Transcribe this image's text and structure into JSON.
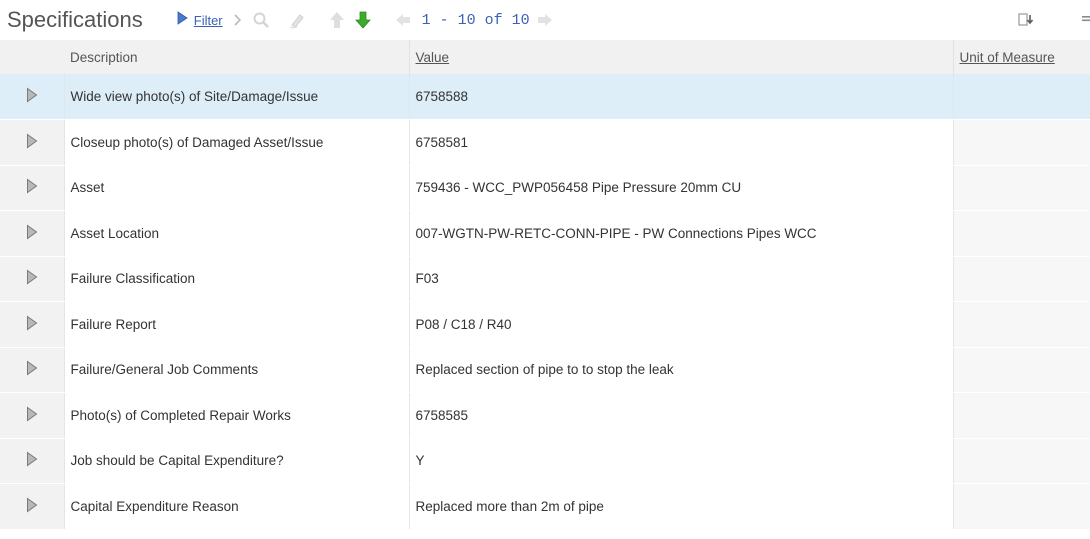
{
  "toolbar": {
    "title": "Specifications",
    "filter_label": "Filter",
    "pager_text": "1 - 10 of 10"
  },
  "table": {
    "headers": {
      "description": "Description",
      "value": "Value",
      "unit": "Unit of Measure"
    },
    "rows": [
      {
        "description": "Wide view photo(s) of Site/Damage/Issue",
        "value": "6758588",
        "unit": ""
      },
      {
        "description": "Closeup photo(s) of Damaged Asset/Issue",
        "value": "6758581",
        "unit": ""
      },
      {
        "description": "Asset",
        "value": "759436 - WCC_PWP056458 Pipe Pressure 20mm CU",
        "unit": ""
      },
      {
        "description": "Asset Location",
        "value": "007-WGTN-PW-RETC-CONN-PIPE - PW Connections Pipes WCC",
        "unit": ""
      },
      {
        "description": "Failure Classification",
        "value": "F03",
        "unit": ""
      },
      {
        "description": "Failure Report",
        "value": "P08 / C18 / R40",
        "unit": ""
      },
      {
        "description": "Failure/General Job Comments",
        "value": "Replaced section of pipe to to stop the leak",
        "unit": ""
      },
      {
        "description": "Photo(s) of Completed Repair Works",
        "value": "6758585",
        "unit": ""
      },
      {
        "description": "Job should be Capital Expenditure?",
        "value": "Y",
        "unit": ""
      },
      {
        "description": "Capital Expenditure Reason",
        "value": "Replaced more than 2m of pipe",
        "unit": ""
      }
    ]
  },
  "colors": {
    "link": "#3a62b8",
    "selected_row": "#ddeef8",
    "header_bg": "#f1f1f1",
    "next_arrow": "#3cab2c"
  },
  "icons": {
    "filter_toggle": "triangle-right-icon",
    "breadcrumb": "chevron-right-icon",
    "search": "magnifier-icon",
    "clear": "eraser-icon",
    "prev_record": "arrow-up-icon",
    "next_record": "arrow-down-icon",
    "prev_page": "arrow-left-icon",
    "next_page": "arrow-right-icon",
    "download": "download-icon",
    "menu": "menu-icon",
    "row_expand": "triangle-right-icon"
  }
}
